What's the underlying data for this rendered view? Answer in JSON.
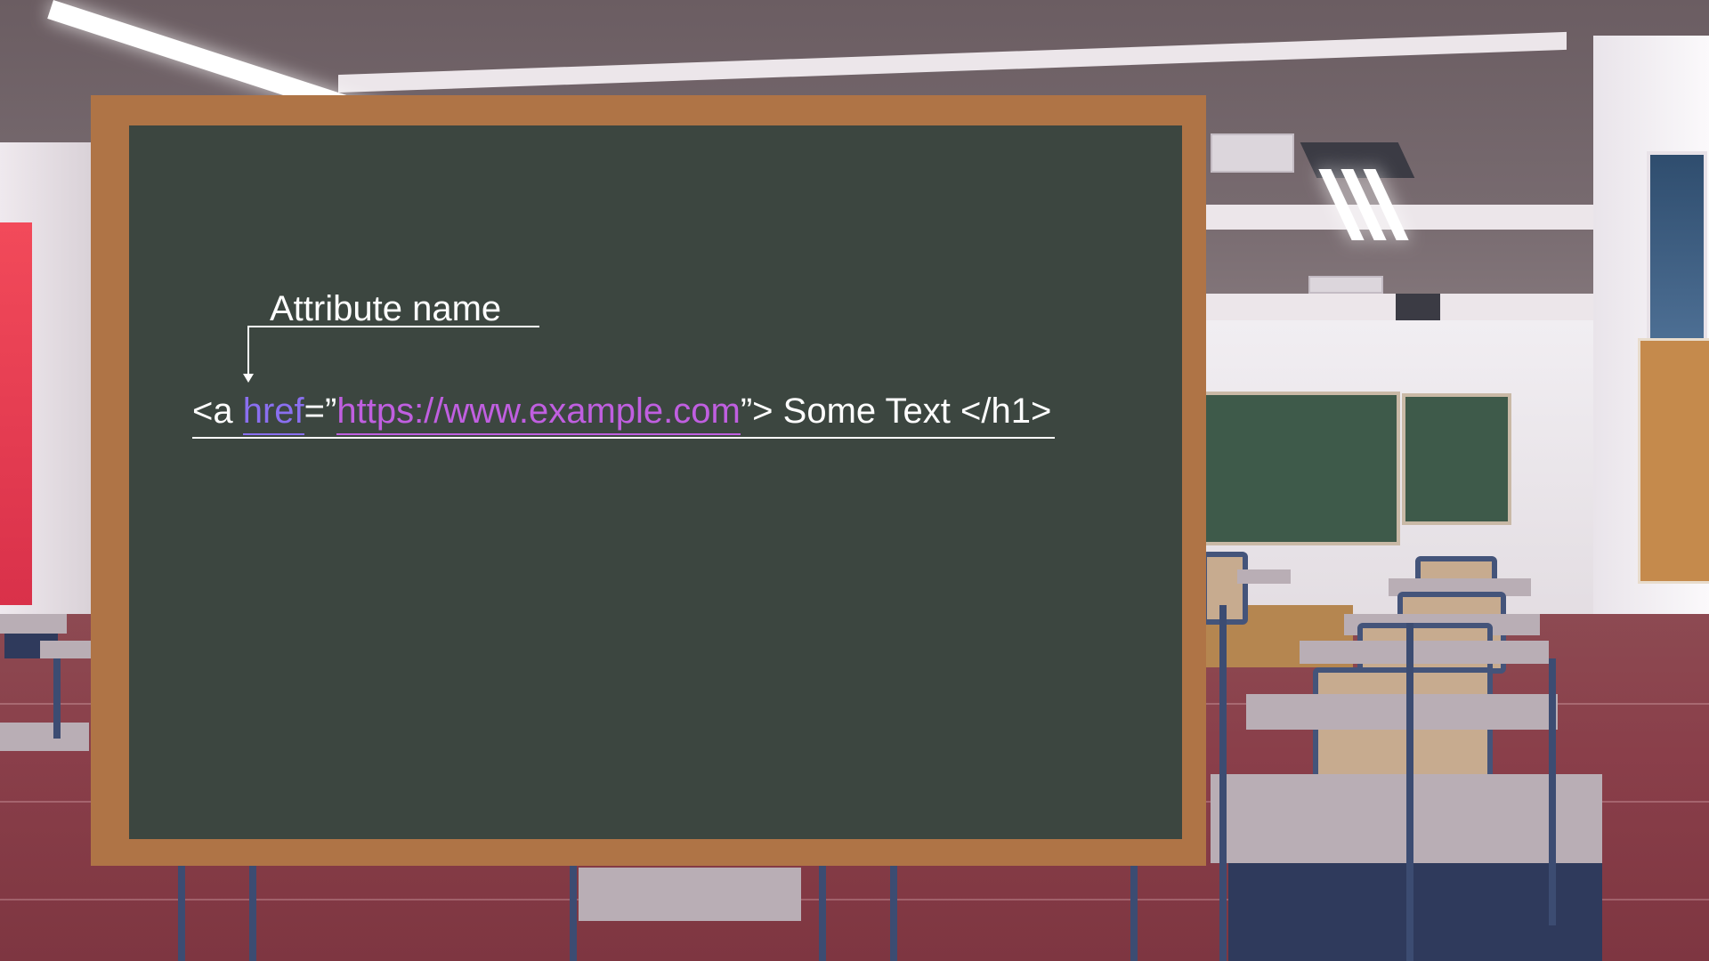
{
  "annotation": {
    "label": "Attribute name"
  },
  "code": {
    "open_tag_start": "<a ",
    "attribute_name": "href",
    "equals_quote": "=”",
    "attribute_value": "https://www.example.com",
    "close_quote_rest": "”> Some Text </h1>"
  },
  "colors": {
    "board": "#3c4640",
    "frame": "#af7446",
    "attribute_name": "#8a6ff0",
    "attribute_value": "#c05fe0",
    "text": "#ffffff"
  }
}
